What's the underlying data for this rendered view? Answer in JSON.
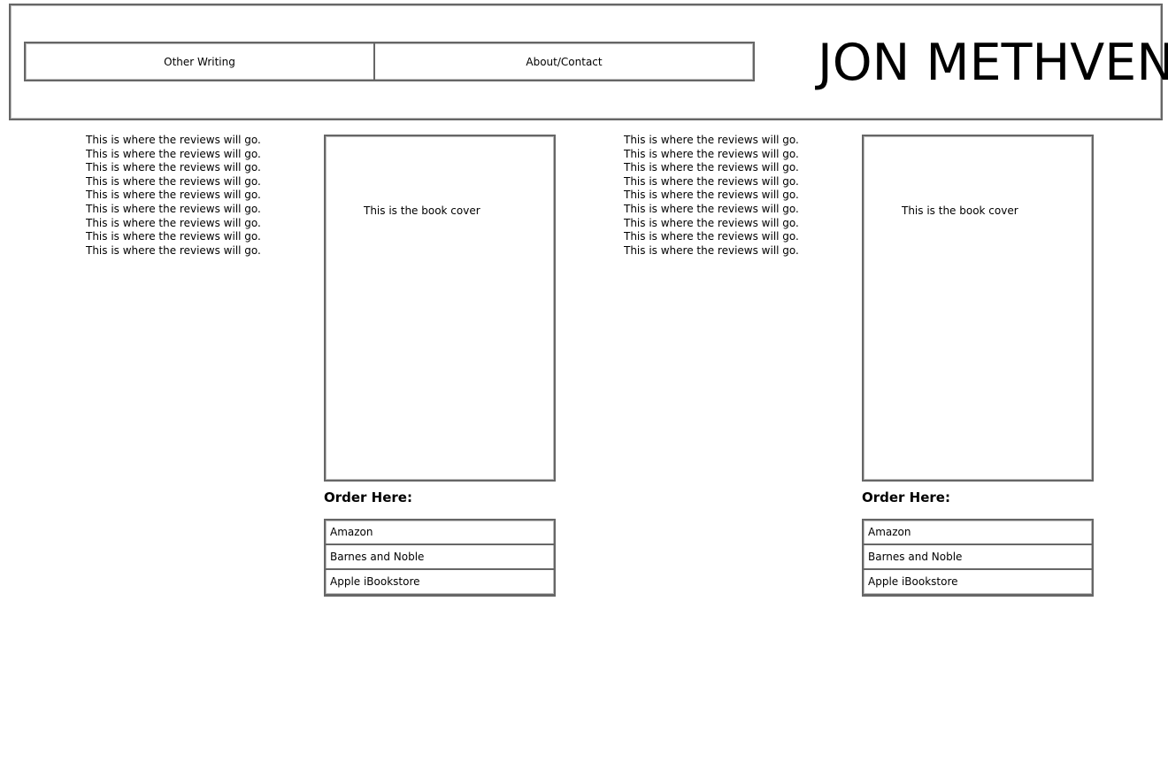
{
  "header": {
    "title": "JON METHVEN",
    "nav": [
      {
        "label": "Other Writing"
      },
      {
        "label": "About/Contact"
      }
    ]
  },
  "books": [
    {
      "reviews": "This is where the reviews will go. This is where the reviews will go. This is where the reviews will go. This is where the reviews will go. This is where the reviews will go. This is where the reviews will go. This is where the reviews will go. This is where the reviews will go. This is where the reviews will go.",
      "cover_text": "This is the book cover",
      "order_heading": "Order Here:",
      "stores": [
        {
          "label": "Amazon"
        },
        {
          "label": "Barnes and Noble"
        },
        {
          "label": "Apple iBookstore"
        }
      ]
    },
    {
      "reviews": "This is where the reviews will go. This is where the reviews will go. This is where the reviews will go. This is where the reviews will go. This is where the reviews will go. This is where the reviews will go. This is where the reviews will go. This is where the reviews will go. This is where the reviews will go.",
      "cover_text": "This is the book cover",
      "order_heading": "Order Here:",
      "stores": [
        {
          "label": "Amazon"
        },
        {
          "label": "Barnes and Noble"
        },
        {
          "label": "Apple iBookstore"
        }
      ]
    }
  ]
}
